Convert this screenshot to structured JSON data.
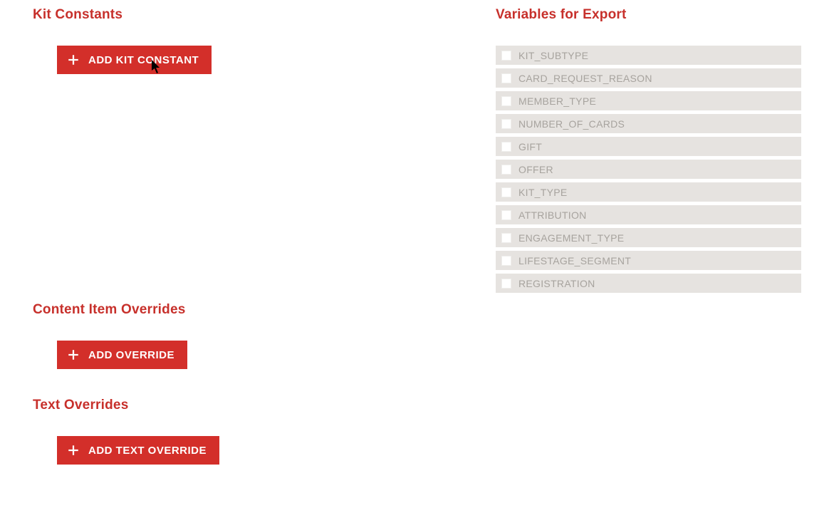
{
  "sections": {
    "kitConstants": {
      "heading": "Kit Constants",
      "addButton": "ADD KIT CONSTANT"
    },
    "contentItemOverrides": {
      "heading": "Content Item Overrides",
      "addButton": "ADD OVERRIDE"
    },
    "textOverrides": {
      "heading": "Text Overrides",
      "addButton": "ADD TEXT OVERRIDE"
    },
    "variablesForExport": {
      "heading": "Variables for Export",
      "items": [
        "KIT_SUBTYPE",
        "CARD_REQUEST_REASON",
        "MEMBER_TYPE",
        "NUMBER_OF_CARDS",
        "GIFT",
        "OFFER",
        "KIT_TYPE",
        "ATTRIBUTION",
        "ENGAGEMENT_TYPE",
        "LIFESTAGE_SEGMENT",
        "REGISTRATION"
      ]
    }
  }
}
